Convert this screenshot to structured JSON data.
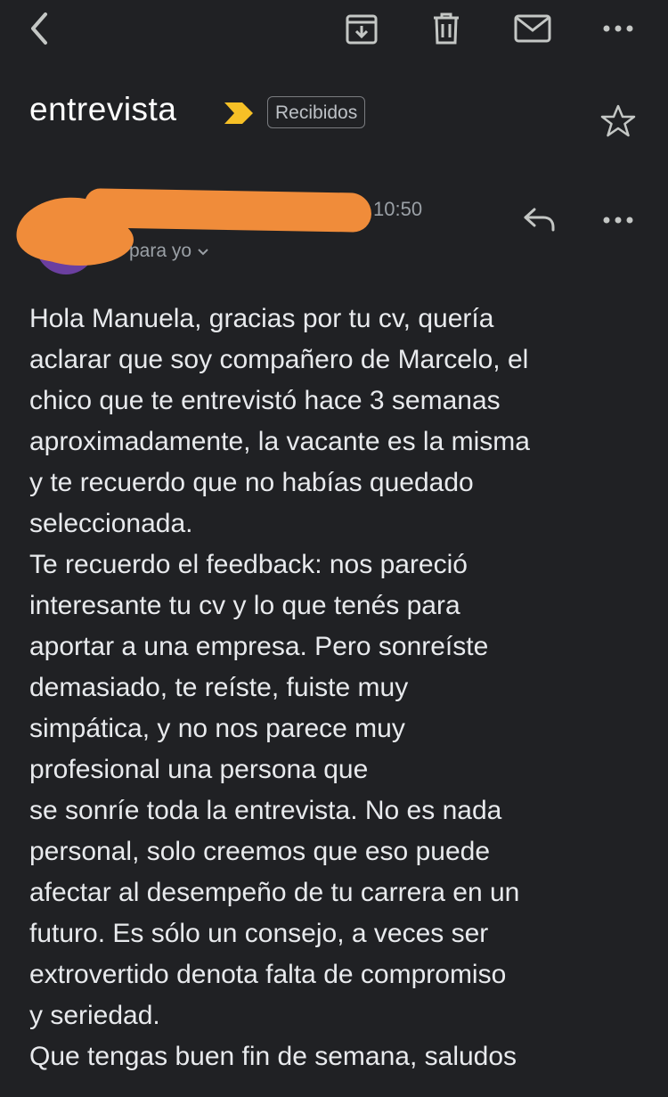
{
  "toolbar": {
    "back_icon": "back-arrow-icon",
    "archive_icon": "archive-icon",
    "delete_icon": "trash-icon",
    "mark_unread_icon": "envelope-icon",
    "more_icon": "more-horizontal-icon"
  },
  "email": {
    "subject": "entrevista",
    "importance_icon": "importance-marker-icon",
    "label": "Recibidos",
    "star_icon": "star-outline-icon",
    "time": "10:50",
    "recipient": "para yo",
    "body": [
      "Hola Manuela, gracias por tu cv, quería\naclarar que soy compañero de Marcelo, el\nchico que te entrevistó hace 3 semanas\naproximadamente, la vacante es la misma\ny te recuerdo que no habías quedado\nseleccionada.",
      "Te recuerdo el feedback: nos pareció\ninteresante tu cv y lo que tenés para\naportar a una empresa. Pero sonreíste\ndemasiado, te reíste, fuiste muy\nsimpática, y no nos parece muy\nprofesional una persona que\nse sonríe toda la entrevista. No es nada\npersonal, solo creemos que eso puede\nafectar al desempeño de tu carrera en un\nfuturo. Es sólo un consejo, a veces ser\nextrovertido denota falta de compromiso\ny seriedad.",
      "Que tengas buen fin de semana, saludos"
    ]
  },
  "colors": {
    "background": "#202124",
    "text": "#e8eaed",
    "muted": "#9aa0a6",
    "importance": "#f6c026",
    "redaction": "#f08c3a"
  }
}
